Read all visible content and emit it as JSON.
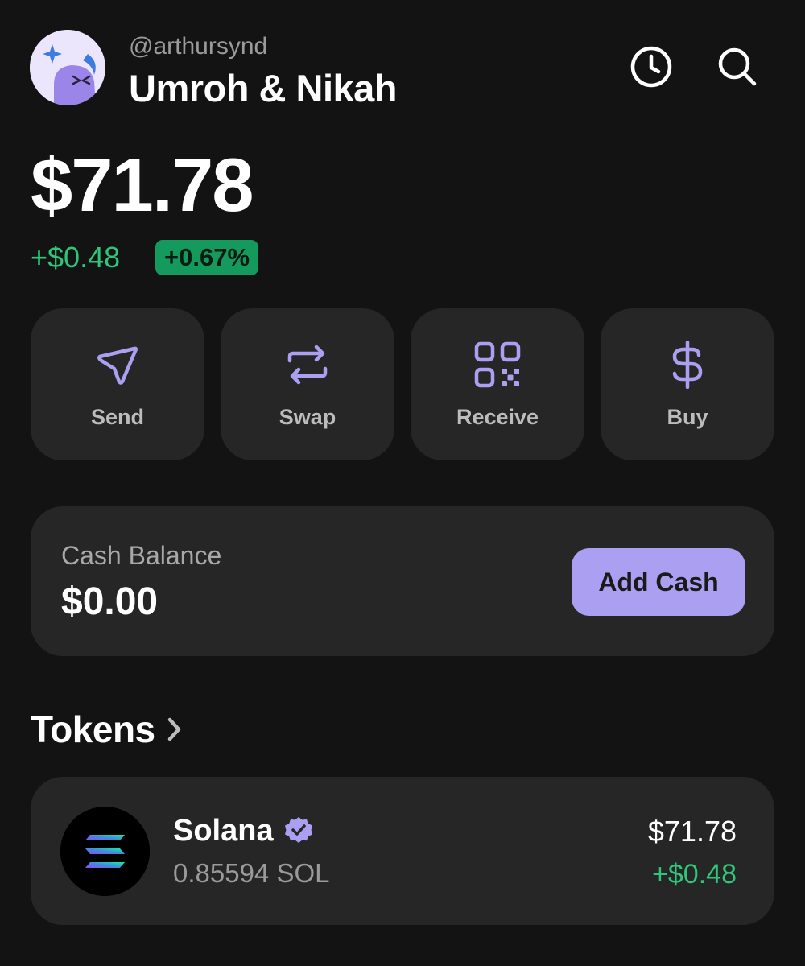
{
  "header": {
    "handle": "@arthursynd",
    "account_name": "Umroh & Nikah",
    "avatar_icon": "sparkle-face-avatar",
    "history_icon": "clock-icon",
    "search_icon": "search-icon"
  },
  "balance": {
    "total": "$71.78",
    "change_amount": "+$0.48",
    "change_percent": "+0.67%"
  },
  "actions": [
    {
      "label": "Send",
      "icon": "send-icon"
    },
    {
      "label": "Swap",
      "icon": "swap-icon"
    },
    {
      "label": "Receive",
      "icon": "qr-code-icon"
    },
    {
      "label": "Buy",
      "icon": "dollar-icon"
    }
  ],
  "cash": {
    "label": "Cash Balance",
    "value": "$0.00",
    "button_label": "Add Cash"
  },
  "tokens": {
    "heading": "Tokens",
    "items": [
      {
        "name": "Solana",
        "verified": true,
        "amount": "0.85594 SOL",
        "value": "$71.78",
        "change": "+$0.48",
        "icon": "solana-logo"
      }
    ]
  },
  "colors": {
    "background": "#131313",
    "card": "#262626",
    "accent": "#ab9ff2",
    "positive": "#2fc67a",
    "positive_badge": "#159a5e"
  }
}
